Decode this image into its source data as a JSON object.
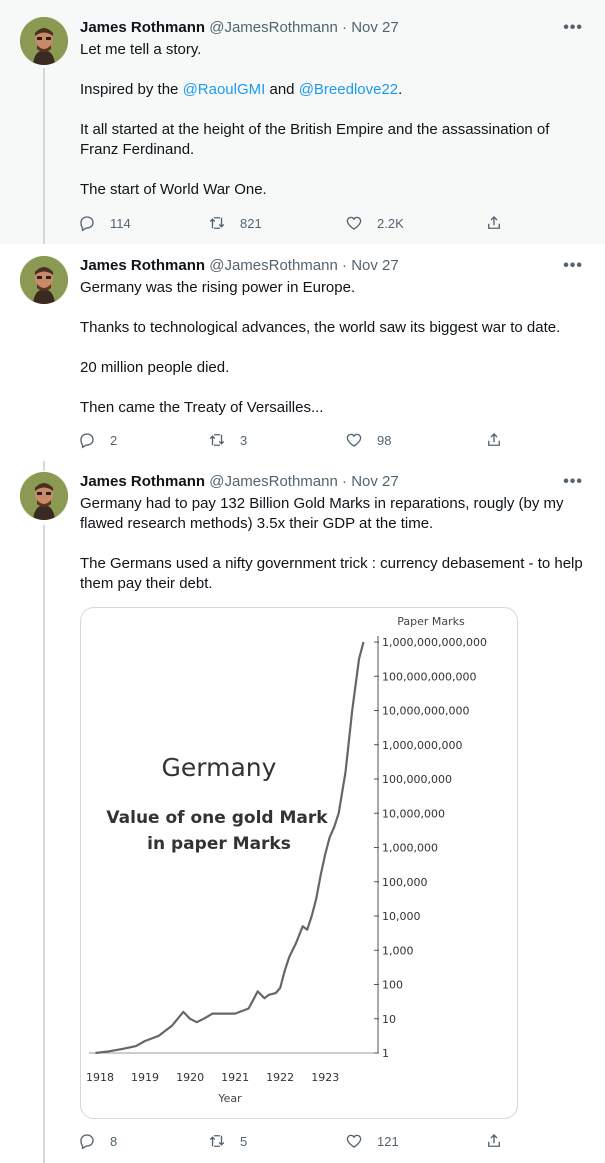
{
  "tweets": [
    {
      "author": {
        "name": "James Rothmann",
        "handle": "@JamesRothmann",
        "date": "Nov 27"
      },
      "paragraphs": [
        "Let me tell a story.",
        "It all started at the height of the British Empire and the assassination of Franz Ferdinand.",
        "The start of World War One."
      ],
      "mention_line": {
        "prefix": "Inspired by the ",
        "mention1": "@RaoulGMI",
        "middle": " and ",
        "mention2": "@Breedlove22",
        "suffix": "."
      },
      "stats": {
        "replies": "114",
        "retweets": "821",
        "likes": "2.2K"
      }
    },
    {
      "author": {
        "name": "James Rothmann",
        "handle": "@JamesRothmann",
        "date": "Nov 27"
      },
      "paragraphs": [
        "Germany was the rising power in Europe.",
        "Thanks to technological advances, the world saw its biggest war to date.",
        "20 million people died.",
        "Then came the Treaty of Versailles..."
      ],
      "stats": {
        "replies": "2",
        "retweets": "3",
        "likes": "98"
      }
    },
    {
      "author": {
        "name": "James Rothmann",
        "handle": "@JamesRothmann",
        "date": "Nov 27"
      },
      "paragraphs": [
        "Germany had to pay 132 Billion Gold Marks in reparations, rougly (by my flawed research methods) 3.5x their GDP at the time.",
        "The Germans used a nifty government trick : currency debasement - to help them pay their debt."
      ],
      "stats": {
        "replies": "8",
        "retweets": "5",
        "likes": "121"
      }
    }
  ],
  "chart_data": {
    "type": "line",
    "title": "Germany",
    "subtitle_lines": [
      "Value of one gold Mark",
      "in paper Marks"
    ],
    "xlabel": "Year",
    "ylabel": "Paper Marks",
    "log_scale": true,
    "x_ticks": [
      "1918",
      "1919",
      "1920",
      "1921",
      "1922",
      "1923"
    ],
    "y_ticks": [
      "1",
      "10",
      "100",
      "1,000",
      "10,000",
      "100,000",
      "1,000,000",
      "10,000,000",
      "100,000,000",
      "1,000,000,000",
      "10,000,000,000",
      "100,000,000,000",
      "1,000,000,000,000"
    ],
    "xlim": [
      1917.8,
      1923.95
    ],
    "ylim_log10": [
      0,
      12
    ],
    "series": [
      {
        "x": [
          1917.9,
          1918.2,
          1918.5,
          1918.8,
          1919.0,
          1919.3,
          1919.6,
          1919.85,
          1920.0,
          1920.15,
          1920.3,
          1920.5,
          1920.7,
          1921.0,
          1921.3,
          1921.5,
          1921.65,
          1921.75,
          1921.9,
          1922.0,
          1922.1,
          1922.2,
          1922.35,
          1922.5,
          1922.6,
          1922.7,
          1922.8,
          1922.9,
          1923.0,
          1923.1,
          1923.2,
          1923.3,
          1923.45,
          1923.6,
          1923.75,
          1923.85
        ],
        "y": [
          0,
          0.05,
          0.12,
          0.2,
          0.35,
          0.5,
          0.8,
          1.2,
          1.0,
          0.9,
          1.0,
          1.15,
          1.15,
          1.15,
          1.3,
          1.8,
          1.6,
          1.7,
          1.75,
          1.9,
          2.4,
          2.8,
          3.2,
          3.7,
          3.6,
          4.0,
          4.5,
          5.2,
          5.8,
          6.3,
          6.6,
          7.0,
          8.2,
          10.0,
          11.5,
          12.0
        ]
      }
    ],
    "line_color": "#666666"
  },
  "colors": {
    "link": "#1d9bf0",
    "secondary_text": "#536471",
    "avatar_bg": "#8a9a52"
  },
  "icons": {
    "reply": "reply-icon",
    "retweet": "retweet-icon",
    "like": "like-icon",
    "share": "share-icon",
    "more": "more-icon"
  },
  "more_glyph": "•••"
}
